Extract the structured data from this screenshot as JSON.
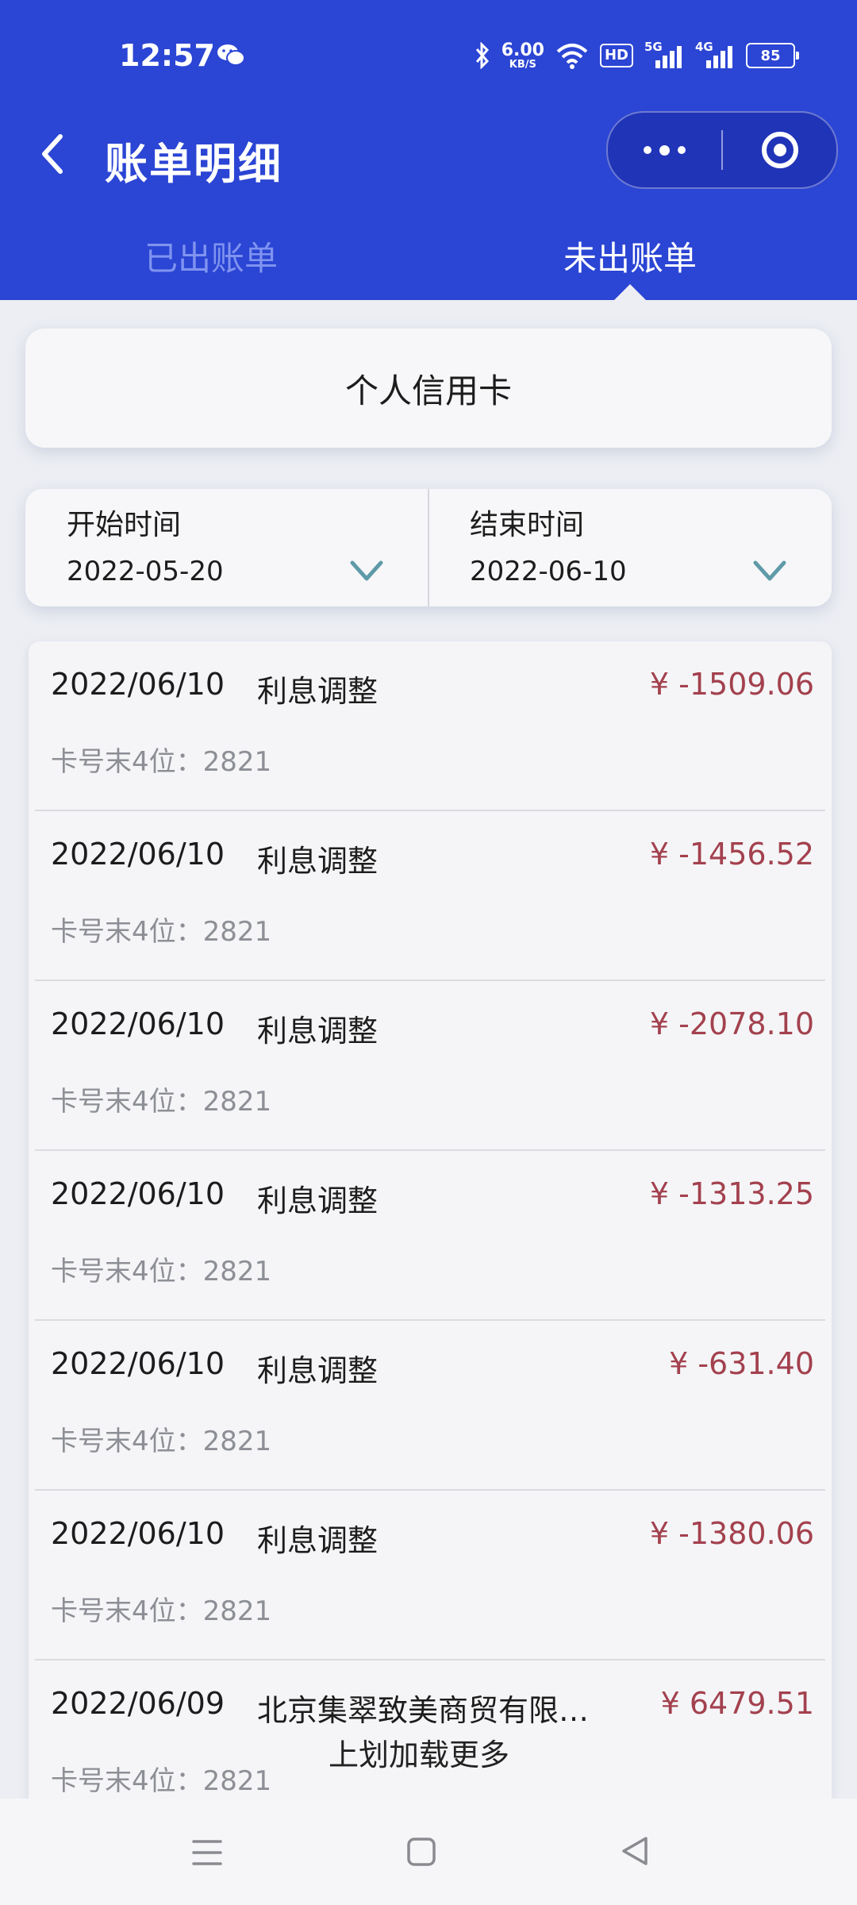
{
  "status_bar": {
    "time": "12:57",
    "net_speed_value": "6.00",
    "net_speed_unit": "KB/S",
    "hd_label": "HD",
    "signal_5g": "5G",
    "signal_4g": "4G",
    "battery": "85"
  },
  "nav": {
    "title": "账单明细",
    "icons": [
      "back-icon",
      "more-icon",
      "close-target-icon"
    ]
  },
  "tabs": [
    {
      "label": "已出账单",
      "active": false
    },
    {
      "label": "未出账单",
      "active": true
    }
  ],
  "card_type": "个人信用卡",
  "date_range": {
    "start_label": "开始时间",
    "start_value": "2022-05-20",
    "end_label": "结束时间",
    "end_value": "2022-06-10"
  },
  "transactions": [
    {
      "date": "2022/06/10",
      "desc": "利息调整",
      "amount": "¥ -1509.06",
      "card": "卡号末4位：2821"
    },
    {
      "date": "2022/06/10",
      "desc": "利息调整",
      "amount": "¥ -1456.52",
      "card": "卡号末4位：2821"
    },
    {
      "date": "2022/06/10",
      "desc": "利息调整",
      "amount": "¥ -2078.10",
      "card": "卡号末4位：2821"
    },
    {
      "date": "2022/06/10",
      "desc": "利息调整",
      "amount": "¥ -1313.25",
      "card": "卡号末4位：2821"
    },
    {
      "date": "2022/06/10",
      "desc": "利息调整",
      "amount": "¥ -631.40",
      "card": "卡号末4位：2821"
    },
    {
      "date": "2022/06/10",
      "desc": "利息调整",
      "amount": "¥ -1380.06",
      "card": "卡号末4位：2821"
    },
    {
      "date": "2022/06/09",
      "desc": "北京集翠致美商贸有限…",
      "amount": "¥ 6479.51",
      "card": "卡号末4位：2821"
    }
  ],
  "load_more": "上划加载更多",
  "colors": {
    "header_bg": "#2b45d4",
    "amount": "#a3414e",
    "page_bg": "#eceef3"
  }
}
